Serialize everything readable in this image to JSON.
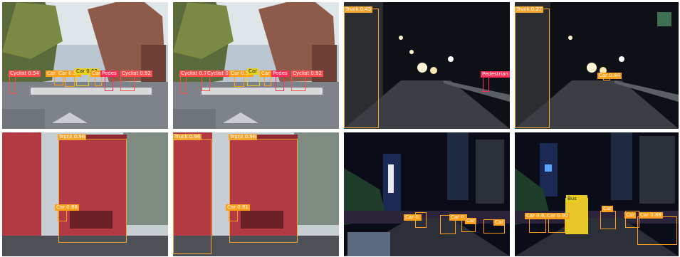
{
  "colors": {
    "car": "#ff9f1a",
    "cyclist": "#ff4d4d",
    "pedestrian": "#ff2d55",
    "truck": "#f7a531",
    "bus": "#e8d21a"
  },
  "panels": [
    {
      "name": "panel-day-street-a",
      "labels": [
        "Cyclist 0.54",
        "Car",
        "Car 0.55",
        "Car 0.62",
        "Car",
        "Pedes",
        "Cyclist 0.92"
      ]
    },
    {
      "name": "panel-day-street-b",
      "labels": [
        "Cyclist 0.78",
        "Cyclist 0.60",
        "Car 0.57",
        "Car",
        "Car",
        "Pedes",
        "Cyclist 0.92"
      ]
    },
    {
      "name": "panel-night-highway-a",
      "labels": [
        "Truck 0.43",
        "Pedestrian"
      ]
    },
    {
      "name": "panel-night-highway-b",
      "labels": [
        "Truck 0.27",
        "Car 0.44"
      ]
    },
    {
      "name": "panel-truck-rear-a",
      "labels": [
        "Truck 0.96",
        "Car 0.88"
      ]
    },
    {
      "name": "panel-truck-rear-b",
      "labels": [
        "Truck 0.96",
        "Truck 0.96",
        "Car 0.81"
      ]
    },
    {
      "name": "panel-night-city-a",
      "labels": [
        "Car 0.",
        "Car 0.",
        "Car",
        "Car"
      ]
    },
    {
      "name": "panel-night-city-b",
      "labels": [
        "Car 0.82",
        "Car 0.90",
        "Bus",
        "Car",
        "Car",
        "Car 0.88"
      ]
    }
  ]
}
